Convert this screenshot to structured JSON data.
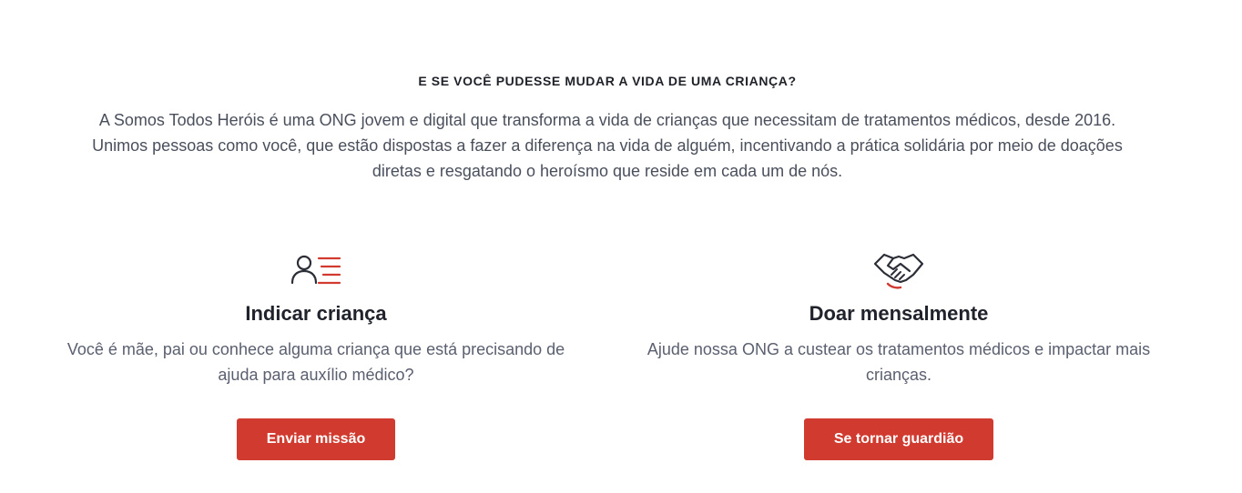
{
  "intro": {
    "heading": "E SE VOCÊ PUDESSE MUDAR A VIDA DE UMA CRIANÇA?",
    "paragraph": "A Somos Todos Heróis é uma ONG jovem e digital que transforma a vida de crianças que necessitam de tratamentos médicos, desde 2016. Unimos pessoas como você, que estão dispostas a fazer a diferença na vida de alguém, incentivando a prática solidária por meio de doações diretas e resgatando o heroísmo que reside em cada um de nós."
  },
  "cards": [
    {
      "icon": "person-list-icon",
      "title": "Indicar criança",
      "text": "Você é mãe, pai ou conhece alguma criança que está precisando de ajuda para auxílio médico?",
      "button_label": "Enviar missão"
    },
    {
      "icon": "handshake-icon",
      "title": "Doar mensalmente",
      "text": "Ajude nossa ONG a custear os tratamentos médicos e impactar mais crianças.",
      "button_label": "Se tornar guardião"
    }
  ],
  "colors": {
    "accent": "#d13a2e",
    "heading": "#1f2128",
    "body_text": "#4a4f5c",
    "icon_stroke": "#2b2e36"
  }
}
